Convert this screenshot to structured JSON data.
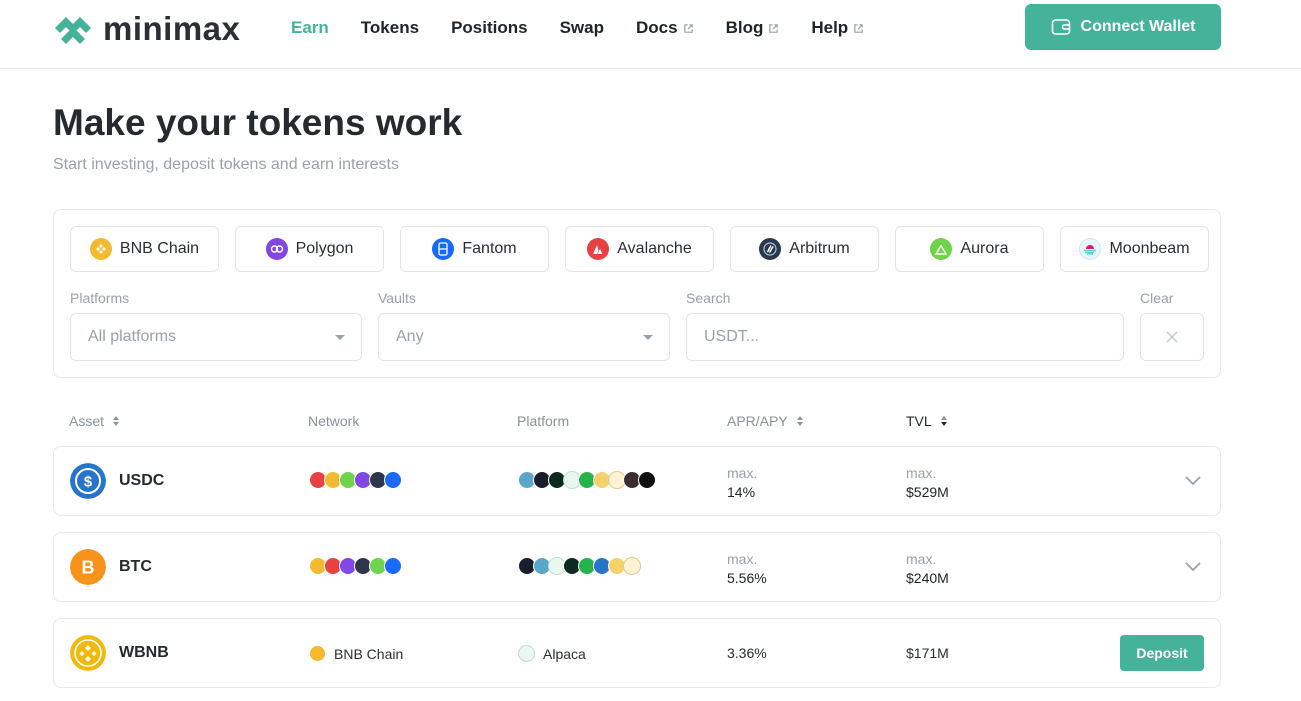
{
  "brand": {
    "name": "minimax",
    "accent": "#44b39a"
  },
  "nav": {
    "items": [
      {
        "label": "Earn",
        "active": true,
        "external": false
      },
      {
        "label": "Tokens",
        "external": false
      },
      {
        "label": "Positions",
        "external": false
      },
      {
        "label": "Swap",
        "external": false
      },
      {
        "label": "Docs",
        "external": true
      },
      {
        "label": "Blog",
        "external": true
      },
      {
        "label": "Help",
        "external": true
      }
    ],
    "connect_label": "Connect Wallet"
  },
  "hero": {
    "title": "Make your tokens work",
    "subtitle": "Start investing, deposit tokens and earn interests"
  },
  "filters": {
    "chains": [
      "BNB Chain",
      "Polygon",
      "Fantom",
      "Avalanche",
      "Arbitrum",
      "Aurora",
      "Moonbeam"
    ],
    "platforms_label": "Platforms",
    "platforms_value": "All platforms",
    "vaults_label": "Vaults",
    "vaults_value": "Any",
    "search_label": "Search",
    "search_placeholder": "USDT...",
    "clear_label": "Clear"
  },
  "table": {
    "headers": {
      "asset": "Asset",
      "network": "Network",
      "platform": "Platform",
      "apr": "APR/APY",
      "tvl": "TVL"
    },
    "rows": [
      {
        "asset": "USDC",
        "apr_prefix": "max.",
        "apr": "14%",
        "tvl_prefix": "max.",
        "tvl": "$529M",
        "expandable": true
      },
      {
        "asset": "BTC",
        "apr_prefix": "max.",
        "apr": "5.56%",
        "tvl_prefix": "max.",
        "tvl": "$240M",
        "expandable": true
      },
      {
        "asset": "WBNB",
        "network": "BNB Chain",
        "platform": "Alpaca",
        "apr": "3.36%",
        "tvl": "$171M",
        "action": "Deposit"
      }
    ]
  }
}
